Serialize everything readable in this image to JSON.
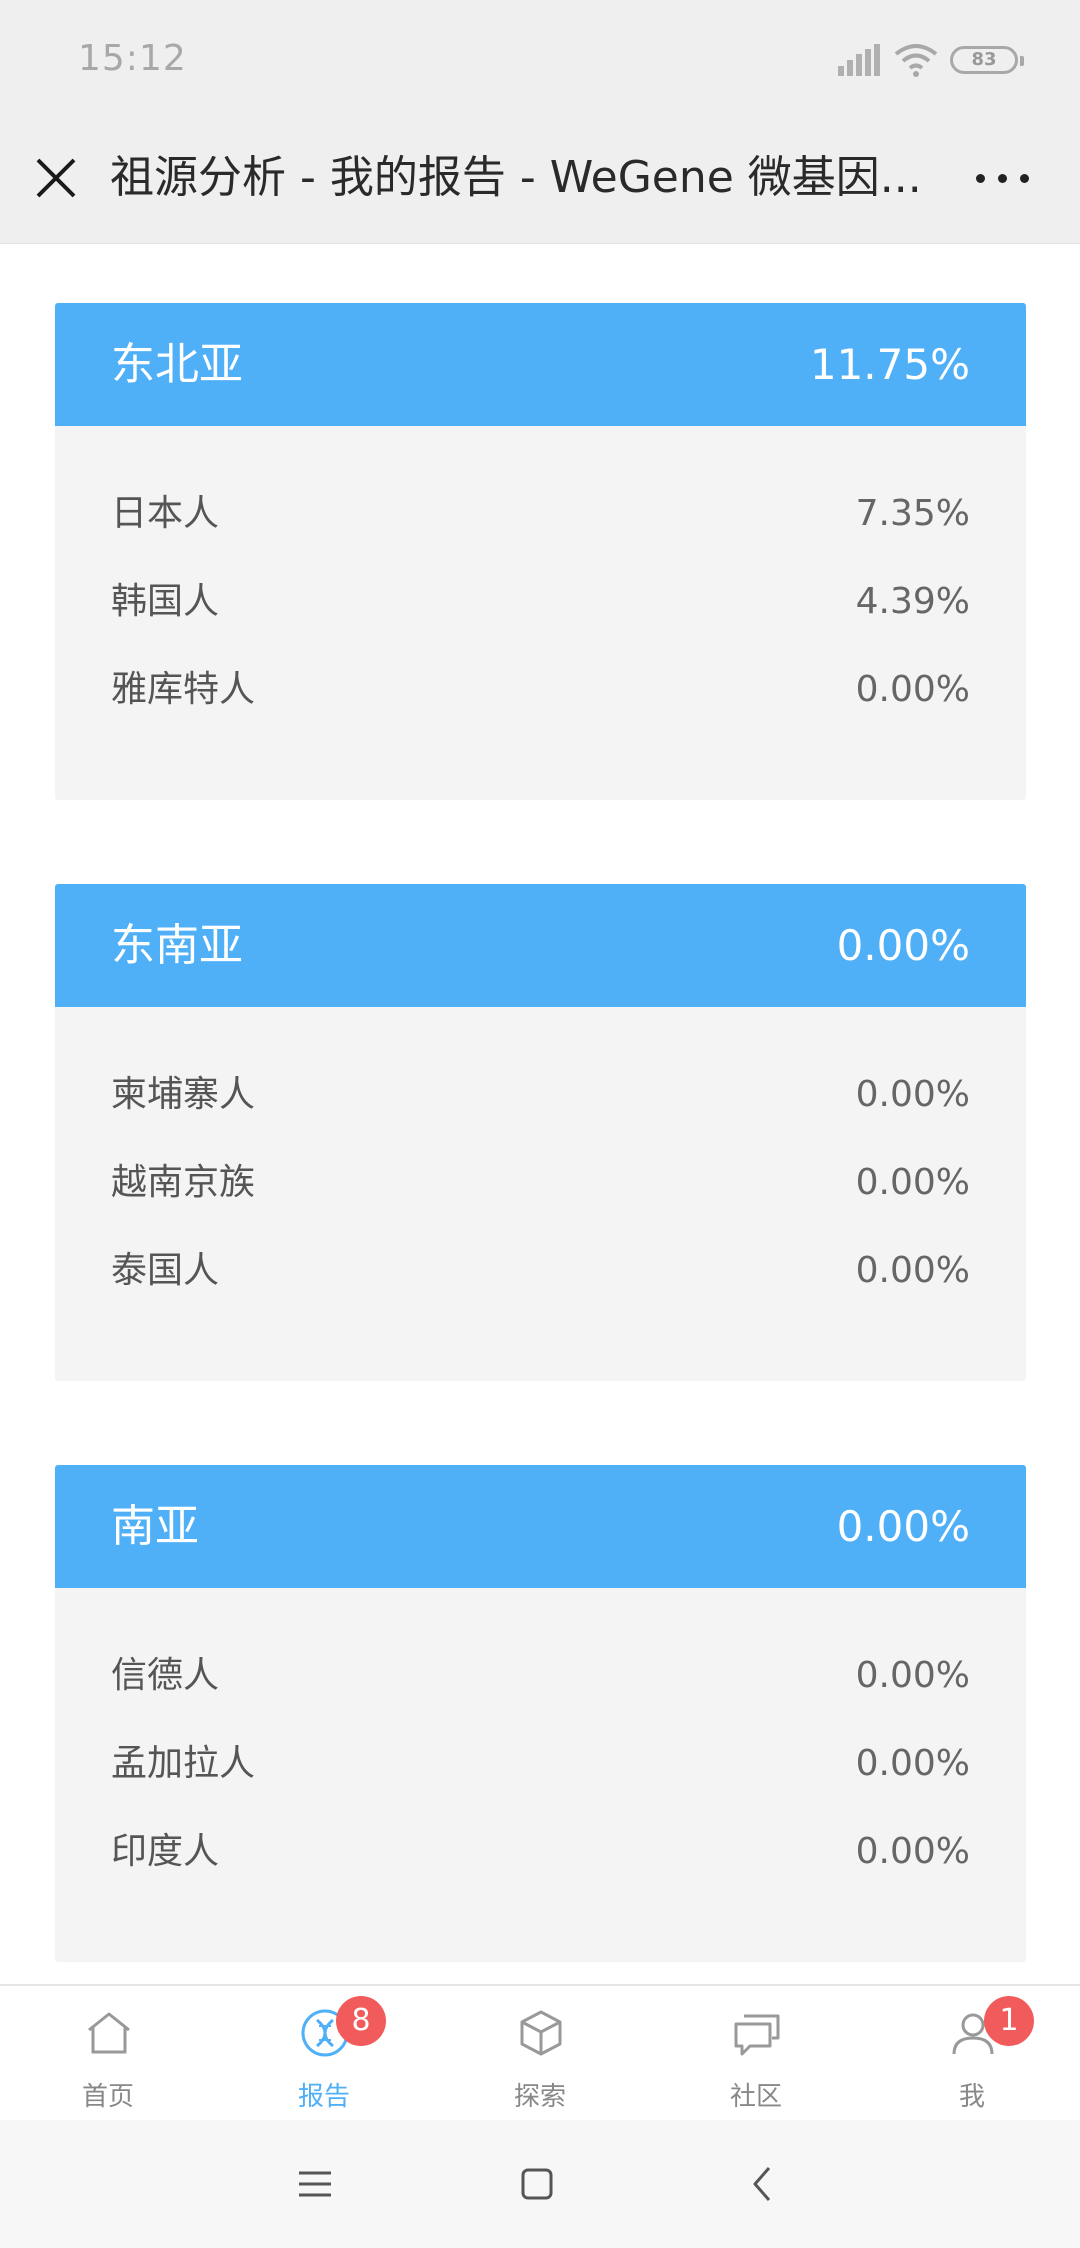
{
  "status": {
    "time": "15:12",
    "battery": "83",
    "icons": [
      "signal-icon",
      "wifi-icon",
      "battery-icon"
    ]
  },
  "titlebar": {
    "title": "祖源分析 - 我的报告 - WeGene 微基因...",
    "close_icon": "close-icon",
    "more_icon": "more-icon"
  },
  "sections": [
    {
      "name": "东北亚",
      "percent": "11.75%",
      "items": [
        {
          "name": "日本人",
          "percent": "7.35%"
        },
        {
          "name": "韩国人",
          "percent": "4.39%"
        },
        {
          "name": "雅库特人",
          "percent": "0.00%"
        }
      ]
    },
    {
      "name": "东南亚",
      "percent": "0.00%",
      "items": [
        {
          "name": "柬埔寨人",
          "percent": "0.00%"
        },
        {
          "name": "越南京族",
          "percent": "0.00%"
        },
        {
          "name": "泰国人",
          "percent": "0.00%"
        }
      ]
    },
    {
      "name": "南亚",
      "percent": "0.00%",
      "items": [
        {
          "name": "信德人",
          "percent": "0.00%"
        },
        {
          "name": "孟加拉人",
          "percent": "0.00%"
        },
        {
          "name": "印度人",
          "percent": "0.00%"
        }
      ]
    }
  ],
  "tabs": [
    {
      "label": "首页",
      "icon": "home-icon"
    },
    {
      "label": "报告",
      "icon": "dna-icon",
      "badge": "8",
      "active": true
    },
    {
      "label": "探索",
      "icon": "cube-icon"
    },
    {
      "label": "社区",
      "icon": "chat-icon"
    },
    {
      "label": "我",
      "icon": "user-icon",
      "badge": "1"
    }
  ],
  "colors": {
    "accent": "#4fb0f7",
    "badge": "#f25b5b",
    "card_bg": "#f4f4f4",
    "bar_bg": "#efefef"
  },
  "system_nav": [
    "menu-icon",
    "home-square-icon",
    "back-icon"
  ]
}
